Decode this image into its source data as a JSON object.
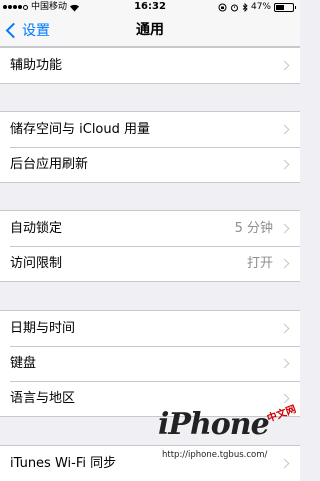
{
  "status_bar": {
    "carrier": "中国移动",
    "time": "16:32",
    "battery": "47%",
    "battery_level": 0.47,
    "signal_bars": 4,
    "icons": [
      "wifi-icon",
      "lock-rotation-icon",
      "alarm-icon",
      "bluetooth-icon",
      "battery-icon"
    ]
  },
  "nav": {
    "back_label": "设置",
    "title": "通用"
  },
  "groups": [
    {
      "rows": [
        {
          "label": "辅助功能"
        }
      ]
    },
    {
      "rows": [
        {
          "label": "储存空间与 iCloud 用量"
        },
        {
          "label": "后台应用刷新"
        }
      ]
    },
    {
      "rows": [
        {
          "label": "自动锁定",
          "value": "5 分钟"
        },
        {
          "label": "访问限制",
          "value": "打开"
        }
      ]
    },
    {
      "rows": [
        {
          "label": "日期与时间"
        },
        {
          "label": "键盘"
        },
        {
          "label": "语言与地区"
        }
      ]
    },
    {
      "rows": [
        {
          "label": "iTunes Wi-Fi 同步"
        }
      ]
    }
  ],
  "watermark": {
    "logo": "iPhone",
    "cn": "中文网",
    "url": "http://iphone.tgbus.com/"
  },
  "colors": {
    "accent": "#007aff",
    "background": "#efeff4",
    "separator": "#c8c7cc",
    "secondary_text": "#8e8e93"
  }
}
